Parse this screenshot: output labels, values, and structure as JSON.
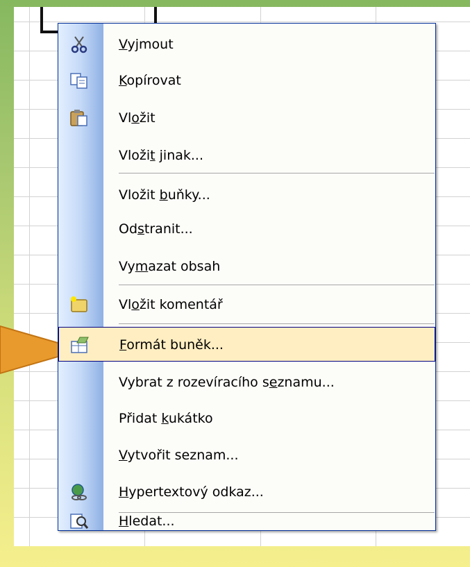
{
  "menu": {
    "items": [
      {
        "pre": "",
        "ul": "V",
        "post": "yjmout",
        "icon": "scissors-icon"
      },
      {
        "pre": "",
        "ul": "K",
        "post": "opírovat",
        "icon": "copy-icon"
      },
      {
        "pre": "Vl",
        "ul": "o",
        "post": "žit",
        "icon": "paste-icon"
      },
      {
        "pre": "Vloži",
        "ul": "t",
        "post": " jinak...",
        "icon": ""
      },
      {
        "pre": "Vložit ",
        "ul": "b",
        "post": "uňky...",
        "icon": ""
      },
      {
        "pre": "Od",
        "ul": "s",
        "post": "tranit...",
        "icon": ""
      },
      {
        "pre": "Vy",
        "ul": "m",
        "post": "azat obsah",
        "icon": ""
      },
      {
        "pre": "Vl",
        "ul": "o",
        "post": "žit komentář",
        "icon": "insert-comment-icon"
      },
      {
        "pre": "",
        "ul": "F",
        "post": "ormát buněk...",
        "icon": "format-cells-icon",
        "highlighted": true
      },
      {
        "pre": "Vybrat z rozevíracího s",
        "ul": "e",
        "post": "znamu...",
        "icon": ""
      },
      {
        "pre": "Přidat ",
        "ul": "k",
        "post": "ukátko",
        "icon": ""
      },
      {
        "pre": "",
        "ul": "V",
        "post": "ytvořit seznam...",
        "icon": ""
      },
      {
        "pre": "",
        "ul": "H",
        "post": "ypertextový odkaz...",
        "icon": "hyperlink-icon"
      },
      {
        "pre": "",
        "ul": "H",
        "post": "ledat...",
        "icon": "research-icon"
      }
    ]
  },
  "colors": {
    "menu_border": "#002d96",
    "highlight_fill": "#ffeec2",
    "pointer": "#e89a2c"
  }
}
